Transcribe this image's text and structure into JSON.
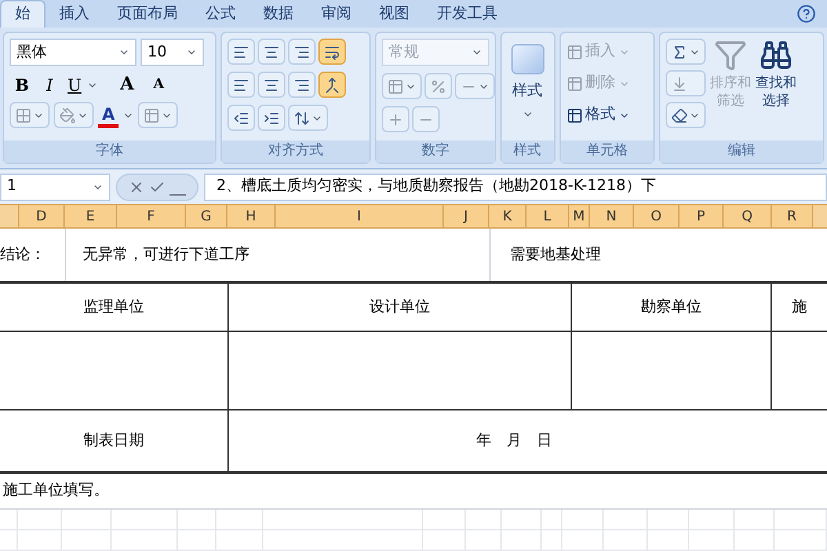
{
  "tabs": [
    {
      "label": "始",
      "selected": true
    },
    {
      "label": "插入",
      "selected": false
    },
    {
      "label": "页面布局",
      "selected": false
    },
    {
      "label": "公式",
      "selected": false
    },
    {
      "label": "数据",
      "selected": false
    },
    {
      "label": "审阅",
      "selected": false
    },
    {
      "label": "视图",
      "selected": false
    },
    {
      "label": "开发工具",
      "selected": false
    }
  ],
  "font_group": {
    "label": "字体",
    "font_name": "黑体",
    "font_size": "10",
    "bold": "B",
    "italic": "I",
    "underline": "U",
    "grow": "A",
    "shrink": "A",
    "font_color": "A"
  },
  "align_group": {
    "label": "对齐方式",
    "wrap_selected": true,
    "merge_selected": true
  },
  "number_group": {
    "label": "数字",
    "format": "常规",
    "disabled": true
  },
  "styles_group": {
    "label": "样式",
    "button": "样式"
  },
  "cells_group": {
    "label": "单元格",
    "buttons": [
      {
        "label": "插入",
        "disabled": true
      },
      {
        "label": "删除",
        "disabled": true
      },
      {
        "label": "格式",
        "disabled": false
      }
    ]
  },
  "editing_group": {
    "label": "编辑",
    "sort": {
      "label": "排序和",
      "label2": "筛选",
      "disabled": true
    },
    "find": {
      "label": "查找和",
      "label2": "选择",
      "disabled": false
    }
  },
  "formula_bar": {
    "name_box": "1",
    "formula": "2、槽底土质均匀密实，与地质勘察报告（地勘2018-K-1218）下"
  },
  "columns": [
    {
      "label": "D",
      "selected": true
    },
    {
      "label": "E",
      "selected": true
    },
    {
      "label": "F",
      "selected": true
    },
    {
      "label": "G",
      "selected": true
    },
    {
      "label": "H",
      "selected": true
    },
    {
      "label": "I",
      "selected": true
    },
    {
      "label": "J",
      "selected": true
    },
    {
      "label": "K",
      "selected": true
    },
    {
      "label": "L",
      "selected": true
    },
    {
      "label": "M",
      "selected": true
    },
    {
      "label": "N",
      "selected": true
    },
    {
      "label": "O",
      "selected": true
    },
    {
      "label": "P",
      "selected": true
    },
    {
      "label": "Q",
      "selected": true
    },
    {
      "label": "R",
      "selected": true
    }
  ],
  "sheet": {
    "conclusion_label": "结论：",
    "option_1": "无异常，可进行下道工序",
    "option_2": "需要地基处理",
    "units": [
      "监理单位",
      "设计单位",
      "勘察单位",
      "施"
    ],
    "date_label": "制表日期",
    "date_value": "年　月　日",
    "note": "施工单位填写。"
  }
}
